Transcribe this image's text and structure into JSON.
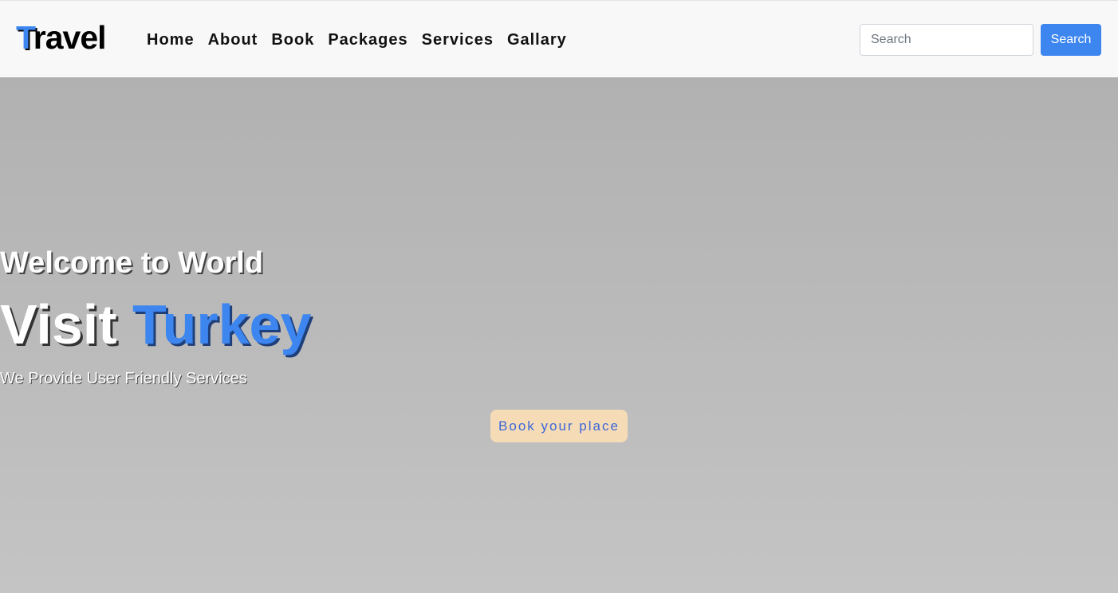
{
  "brand": {
    "first_letter": "T",
    "rest": "ravel"
  },
  "nav": {
    "items": [
      {
        "label": "Home"
      },
      {
        "label": "About"
      },
      {
        "label": "Book"
      },
      {
        "label": "Packages"
      },
      {
        "label": "Services"
      },
      {
        "label": "Gallary"
      }
    ]
  },
  "search": {
    "placeholder": "Search",
    "value": "",
    "button_label": "Search"
  },
  "hero": {
    "welcome": "Welcome to World",
    "title_part1": "Visit ",
    "title_part2": "Turkey",
    "subtitle": "We Provide User Friendly Services",
    "cta_label": "Book your place"
  },
  "colors": {
    "accent": "#3d86f0",
    "navbar_bg": "#f8f8f8",
    "cta_bg": "#f5dcb7",
    "cta_text": "#3d66d8",
    "hero_bg_top": "#b1b1b1",
    "hero_bg_bottom": "#c4c4c4"
  }
}
